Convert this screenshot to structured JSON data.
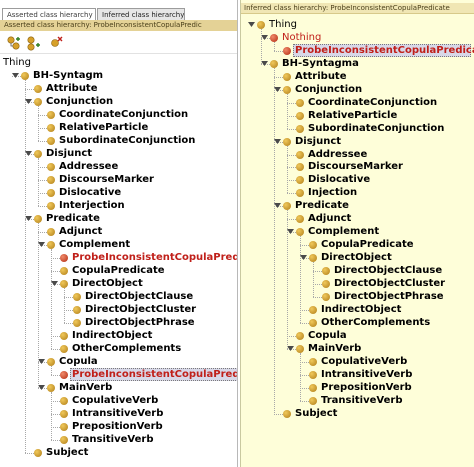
{
  "left": {
    "tabs": [
      {
        "label": "Asserted class hierarchy",
        "active": true
      },
      {
        "label": "Inferred class hierarchy",
        "active": false
      }
    ],
    "header": "Asserted class hierarchy: ProbeInconsistentCopulaPredic",
    "toolbar": [
      {
        "icon": "add-subclass-icon"
      },
      {
        "icon": "add-sibling-class-icon"
      },
      {
        "icon": "delete-class-icon"
      }
    ],
    "tree": [
      {
        "id": "thing",
        "label": "Thing",
        "depth": 0,
        "style": "plain",
        "bullet": "none",
        "toggle": "none"
      },
      {
        "id": "bh-syntagm",
        "label": "BH-Syntagm",
        "depth": 1,
        "style": "bold",
        "bullet": "gold",
        "toggle": "open"
      },
      {
        "id": "attribute",
        "label": "Attribute",
        "depth": 2,
        "style": "bold",
        "bullet": "gold",
        "toggle": "none"
      },
      {
        "id": "conjunction",
        "label": "Conjunction",
        "depth": 2,
        "style": "bold",
        "bullet": "gold",
        "toggle": "open"
      },
      {
        "id": "coordinateconjunction",
        "label": "CoordinateConjunction",
        "depth": 3,
        "style": "bold",
        "bullet": "gold",
        "toggle": "none"
      },
      {
        "id": "relativeparticle",
        "label": "RelativeParticle",
        "depth": 3,
        "style": "bold",
        "bullet": "gold",
        "toggle": "none"
      },
      {
        "id": "subordinateconjunction",
        "label": "SubordinateConjunction",
        "depth": 3,
        "style": "bold",
        "bullet": "gold",
        "toggle": "none"
      },
      {
        "id": "disjunct",
        "label": "Disjunct",
        "depth": 2,
        "style": "bold",
        "bullet": "gold",
        "toggle": "open"
      },
      {
        "id": "addressee",
        "label": "Addressee",
        "depth": 3,
        "style": "bold",
        "bullet": "gold",
        "toggle": "none"
      },
      {
        "id": "discoursemarker",
        "label": "DiscourseMarker",
        "depth": 3,
        "style": "bold",
        "bullet": "gold",
        "toggle": "none"
      },
      {
        "id": "dislocative",
        "label": "Dislocative",
        "depth": 3,
        "style": "bold",
        "bullet": "gold",
        "toggle": "none"
      },
      {
        "id": "interjection",
        "label": "Interjection",
        "depth": 3,
        "style": "bold",
        "bullet": "gold",
        "toggle": "none"
      },
      {
        "id": "predicate",
        "label": "Predicate",
        "depth": 2,
        "style": "bold",
        "bullet": "gold",
        "toggle": "open"
      },
      {
        "id": "adjunct",
        "label": "Adjunct",
        "depth": 3,
        "style": "bold",
        "bullet": "gold",
        "toggle": "none"
      },
      {
        "id": "complement",
        "label": "Complement",
        "depth": 3,
        "style": "bold",
        "bullet": "gold",
        "toggle": "open"
      },
      {
        "id": "probe1",
        "label": "ProbeInconsistentCopulaPredicate",
        "depth": 4,
        "style": "red",
        "bullet": "red",
        "toggle": "none"
      },
      {
        "id": "copulapredicate",
        "label": "CopulaPredicate",
        "depth": 4,
        "style": "bold",
        "bullet": "gold",
        "toggle": "none"
      },
      {
        "id": "directobject",
        "label": "DirectObject",
        "depth": 4,
        "style": "bold",
        "bullet": "gold",
        "toggle": "open"
      },
      {
        "id": "directobjectclause",
        "label": "DirectObjectClause",
        "depth": 5,
        "style": "bold",
        "bullet": "gold",
        "toggle": "none"
      },
      {
        "id": "directobjectcluster",
        "label": "DirectObjectCluster",
        "depth": 5,
        "style": "bold",
        "bullet": "gold",
        "toggle": "none"
      },
      {
        "id": "directobjectphrase",
        "label": "DirectObjectPhrase",
        "depth": 5,
        "style": "bold",
        "bullet": "gold",
        "toggle": "none"
      },
      {
        "id": "indirectobject",
        "label": "IndirectObject",
        "depth": 4,
        "style": "bold",
        "bullet": "gold",
        "toggle": "none"
      },
      {
        "id": "othercomplements",
        "label": "OtherComplements",
        "depth": 4,
        "style": "bold",
        "bullet": "gold",
        "toggle": "none"
      },
      {
        "id": "copula",
        "label": "Copula",
        "depth": 3,
        "style": "bold",
        "bullet": "gold",
        "toggle": "open"
      },
      {
        "id": "probe2",
        "label": "ProbeInconsistentCopulaPredicate",
        "depth": 4,
        "style": "red",
        "bullet": "red",
        "toggle": "none",
        "selected": true
      },
      {
        "id": "mainverb",
        "label": "MainVerb",
        "depth": 3,
        "style": "bold",
        "bullet": "gold",
        "toggle": "open"
      },
      {
        "id": "copulativeverb",
        "label": "CopulativeVerb",
        "depth": 4,
        "style": "bold",
        "bullet": "gold",
        "toggle": "none"
      },
      {
        "id": "intransitiveverb",
        "label": "IntransitiveVerb",
        "depth": 4,
        "style": "bold",
        "bullet": "gold",
        "toggle": "none"
      },
      {
        "id": "prepositionverb",
        "label": "PrepositionVerb",
        "depth": 4,
        "style": "bold",
        "bullet": "gold",
        "toggle": "none"
      },
      {
        "id": "transitiveverb",
        "label": "TransitiveVerb",
        "depth": 4,
        "style": "bold",
        "bullet": "gold",
        "toggle": "none"
      },
      {
        "id": "subject",
        "label": "Subject",
        "depth": 2,
        "style": "bold",
        "bullet": "gold",
        "toggle": "none"
      }
    ]
  },
  "right": {
    "header": "Inferred class hierarchy: ProbeInconsistentCopulaPredicate",
    "tree": [
      {
        "id": "r-thing",
        "label": "Thing",
        "depth": 0,
        "style": "plain",
        "bullet": "gold",
        "toggle": "open"
      },
      {
        "id": "r-nothing",
        "label": "Nothing",
        "depth": 1,
        "style": "redplain",
        "bullet": "red",
        "toggle": "open"
      },
      {
        "id": "r-probe",
        "label": "ProbeInconsistentCopulaPredicate",
        "depth": 2,
        "style": "red",
        "bullet": "red",
        "toggle": "none",
        "selected": true
      },
      {
        "id": "r-bh-syntagma",
        "label": "BH-Syntagma",
        "depth": 1,
        "style": "bold",
        "bullet": "gold",
        "toggle": "open"
      },
      {
        "id": "r-attribute",
        "label": "Attribute",
        "depth": 2,
        "style": "bold",
        "bullet": "gold",
        "toggle": "none"
      },
      {
        "id": "r-conjunction",
        "label": "Conjunction",
        "depth": 2,
        "style": "bold",
        "bullet": "gold",
        "toggle": "open"
      },
      {
        "id": "r-coordinateconjunction",
        "label": "CoordinateConjunction",
        "depth": 3,
        "style": "bold",
        "bullet": "gold",
        "toggle": "none"
      },
      {
        "id": "r-relativeparticle",
        "label": "RelativeParticle",
        "depth": 3,
        "style": "bold",
        "bullet": "gold",
        "toggle": "none"
      },
      {
        "id": "r-subordinateconjunction",
        "label": "SubordinateConjunction",
        "depth": 3,
        "style": "bold",
        "bullet": "gold",
        "toggle": "none"
      },
      {
        "id": "r-disjunct",
        "label": "Disjunct",
        "depth": 2,
        "style": "bold",
        "bullet": "gold",
        "toggle": "open"
      },
      {
        "id": "r-addressee",
        "label": "Addressee",
        "depth": 3,
        "style": "bold",
        "bullet": "gold",
        "toggle": "none"
      },
      {
        "id": "r-discoursemarker",
        "label": "DiscourseMarker",
        "depth": 3,
        "style": "bold",
        "bullet": "gold",
        "toggle": "none"
      },
      {
        "id": "r-dislocative",
        "label": "Dislocative",
        "depth": 3,
        "style": "bold",
        "bullet": "gold",
        "toggle": "none"
      },
      {
        "id": "r-injection",
        "label": "Injection",
        "depth": 3,
        "style": "bold",
        "bullet": "gold",
        "toggle": "none"
      },
      {
        "id": "r-predicate",
        "label": "Predicate",
        "depth": 2,
        "style": "bold",
        "bullet": "gold",
        "toggle": "open"
      },
      {
        "id": "r-adjunct",
        "label": "Adjunct",
        "depth": 3,
        "style": "bold",
        "bullet": "gold",
        "toggle": "none"
      },
      {
        "id": "r-complement",
        "label": "Complement",
        "depth": 3,
        "style": "bold",
        "bullet": "gold",
        "toggle": "open"
      },
      {
        "id": "r-copulapredicate",
        "label": "CopulaPredicate",
        "depth": 4,
        "style": "bold",
        "bullet": "gold",
        "toggle": "none"
      },
      {
        "id": "r-directobject",
        "label": "DirectObject",
        "depth": 4,
        "style": "bold",
        "bullet": "gold",
        "toggle": "open"
      },
      {
        "id": "r-directobjectclause",
        "label": "DirectObjectClause",
        "depth": 5,
        "style": "bold",
        "bullet": "gold",
        "toggle": "none"
      },
      {
        "id": "r-directobjectcluster",
        "label": "DirectObjectCluster",
        "depth": 5,
        "style": "bold",
        "bullet": "gold",
        "toggle": "none"
      },
      {
        "id": "r-directobjectphrase",
        "label": "DirectObjectPhrase",
        "depth": 5,
        "style": "bold",
        "bullet": "gold",
        "toggle": "none"
      },
      {
        "id": "r-indirectobject",
        "label": "IndirectObject",
        "depth": 4,
        "style": "bold",
        "bullet": "gold",
        "toggle": "none"
      },
      {
        "id": "r-othercomplements",
        "label": "OtherComplements",
        "depth": 4,
        "style": "bold",
        "bullet": "gold",
        "toggle": "none"
      },
      {
        "id": "r-copula",
        "label": "Copula",
        "depth": 3,
        "style": "bold",
        "bullet": "gold",
        "toggle": "none"
      },
      {
        "id": "r-mainverb",
        "label": "MainVerb",
        "depth": 3,
        "style": "bold",
        "bullet": "gold",
        "toggle": "open"
      },
      {
        "id": "r-copulativeverb",
        "label": "CopulativeVerb",
        "depth": 4,
        "style": "bold",
        "bullet": "gold",
        "toggle": "none"
      },
      {
        "id": "r-intransitiveverb",
        "label": "IntransitiveVerb",
        "depth": 4,
        "style": "bold",
        "bullet": "gold",
        "toggle": "none"
      },
      {
        "id": "r-prepositionverb",
        "label": "PrepositionVerb",
        "depth": 4,
        "style": "bold",
        "bullet": "gold",
        "toggle": "none"
      },
      {
        "id": "r-transitiveverb",
        "label": "TransitiveVerb",
        "depth": 4,
        "style": "bold",
        "bullet": "gold",
        "toggle": "none"
      },
      {
        "id": "r-subject",
        "label": "Subject",
        "depth": 2,
        "style": "bold",
        "bullet": "gold",
        "toggle": "none"
      }
    ]
  },
  "colors": {
    "left_header_bg": "#e4d296",
    "right_panel_bg": "#fefed9",
    "unsatisfiable_text": "#c0201a",
    "selection_bg": "#d8d8e8"
  }
}
